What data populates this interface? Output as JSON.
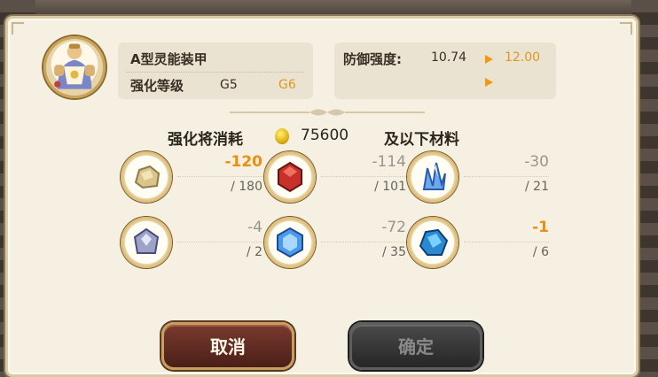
{
  "equipment": {
    "name": "A型灵能装甲",
    "enhance_label": "强化等级",
    "grade_from": "G5",
    "grade_to": "G6"
  },
  "defense": {
    "label": "防御强度:",
    "value_from": "10.74",
    "value_to": "12.00"
  },
  "cost": {
    "label": "强化将消耗",
    "amount": "75600",
    "suffix": "及以下材料"
  },
  "materials": [
    {
      "icon": "stone-ore-icon",
      "need": "-120",
      "have": "/ 180",
      "short": true
    },
    {
      "icon": "red-gem-icon",
      "need": "-114",
      "have": "/ 101",
      "short": false
    },
    {
      "icon": "blue-crystal-cluster-icon",
      "need": "-30",
      "have": "/ 21",
      "short": false
    },
    {
      "icon": "silver-gem-icon",
      "need": "-4",
      "have": "/ 2",
      "short": false
    },
    {
      "icon": "blue-hexagon-gem-icon",
      "need": "-72",
      "have": "/ 35",
      "short": false
    },
    {
      "icon": "blue-ore-icon",
      "need": "-1",
      "have": "/ 6",
      "short": true
    }
  ],
  "buttons": {
    "cancel": "取消",
    "confirm": "确定"
  },
  "colors": {
    "accent_orange": "#e3961a",
    "panel_bg": "#ebe3d2",
    "dialog_bg": "#f6f0e2"
  }
}
